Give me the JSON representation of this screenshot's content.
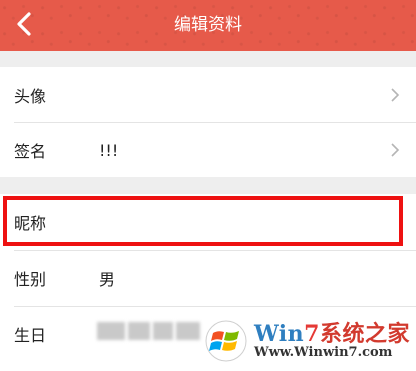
{
  "header": {
    "title": "编辑资料",
    "background_color": "#e65a4a",
    "back_icon": "chevron-left-icon"
  },
  "profile": {
    "avatar_label": "头像",
    "signature_label": "签名",
    "signature_value": "!!!",
    "nickname_label": "昵称",
    "gender_label": "性别",
    "gender_value": "男",
    "birthday_label": "生日"
  },
  "highlight": {
    "target": "nickname",
    "color": "#ee1111"
  },
  "watermark": {
    "brand_prefix": "Win",
    "brand_seven": "7",
    "brand_suffix": "系统之家",
    "url": "Www.Winwin7.com"
  }
}
